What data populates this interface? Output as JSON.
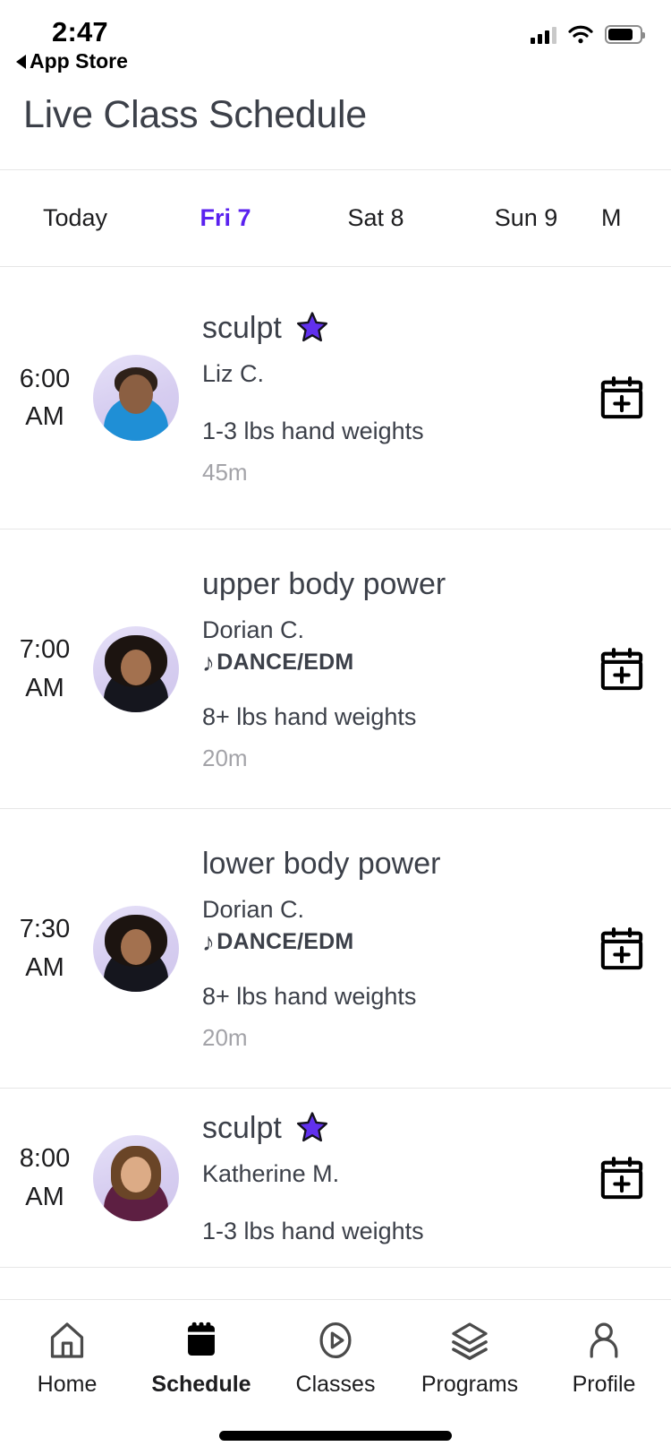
{
  "status_bar": {
    "time": "2:47",
    "back_label": "App Store",
    "signal_bars_filled": 3,
    "signal_bars_total": 4,
    "wifi": "wifi-icon",
    "battery_level_pct": 78
  },
  "header": {
    "title": "Live Class Schedule"
  },
  "day_tabs": {
    "items": [
      {
        "label": "Today",
        "active": false
      },
      {
        "label": "Fri 7",
        "active": true
      },
      {
        "label": "Sat 8",
        "active": false
      },
      {
        "label": "Sun 9",
        "active": false
      },
      {
        "label": "M",
        "active": false
      }
    ],
    "active_color": "#5a21ef"
  },
  "classes": [
    {
      "time": "6:00",
      "ampm": "AM",
      "title": "sculpt",
      "badge": "star-icon",
      "coach": "Liz C.",
      "music": null,
      "equipment": "1-3 lbs hand weights",
      "duration": "45m",
      "action": "add-to-calendar-icon"
    },
    {
      "time": "7:00",
      "ampm": "AM",
      "title": "upper body power",
      "badge": null,
      "coach": "Dorian C.",
      "music": "DANCE/EDM",
      "equipment": "8+ lbs hand weights",
      "duration": "20m",
      "action": "add-to-calendar-icon"
    },
    {
      "time": "7:30",
      "ampm": "AM",
      "title": "lower body power",
      "badge": null,
      "coach": "Dorian C.",
      "music": "DANCE/EDM",
      "equipment": "8+ lbs hand weights",
      "duration": "20m",
      "action": "add-to-calendar-icon"
    },
    {
      "time": "8:00",
      "ampm": "AM",
      "title": "sculpt",
      "badge": "star-icon",
      "coach": "Katherine M.",
      "music": null,
      "equipment": "1-3 lbs hand weights",
      "duration": null,
      "action": "add-to-calendar-icon"
    }
  ],
  "tab_bar": {
    "items": [
      {
        "label": "Home",
        "icon": "home-icon",
        "active": false
      },
      {
        "label": "Schedule",
        "icon": "calendar-icon",
        "active": true
      },
      {
        "label": "Classes",
        "icon": "play-circle-icon",
        "active": false
      },
      {
        "label": "Programs",
        "icon": "layers-icon",
        "active": false
      },
      {
        "label": "Profile",
        "icon": "person-icon",
        "active": false
      }
    ]
  },
  "colors": {
    "accent": "#5a21ef",
    "text": "#3c4049",
    "muted": "#a3a3a8",
    "divider": "#e6e6e6"
  }
}
